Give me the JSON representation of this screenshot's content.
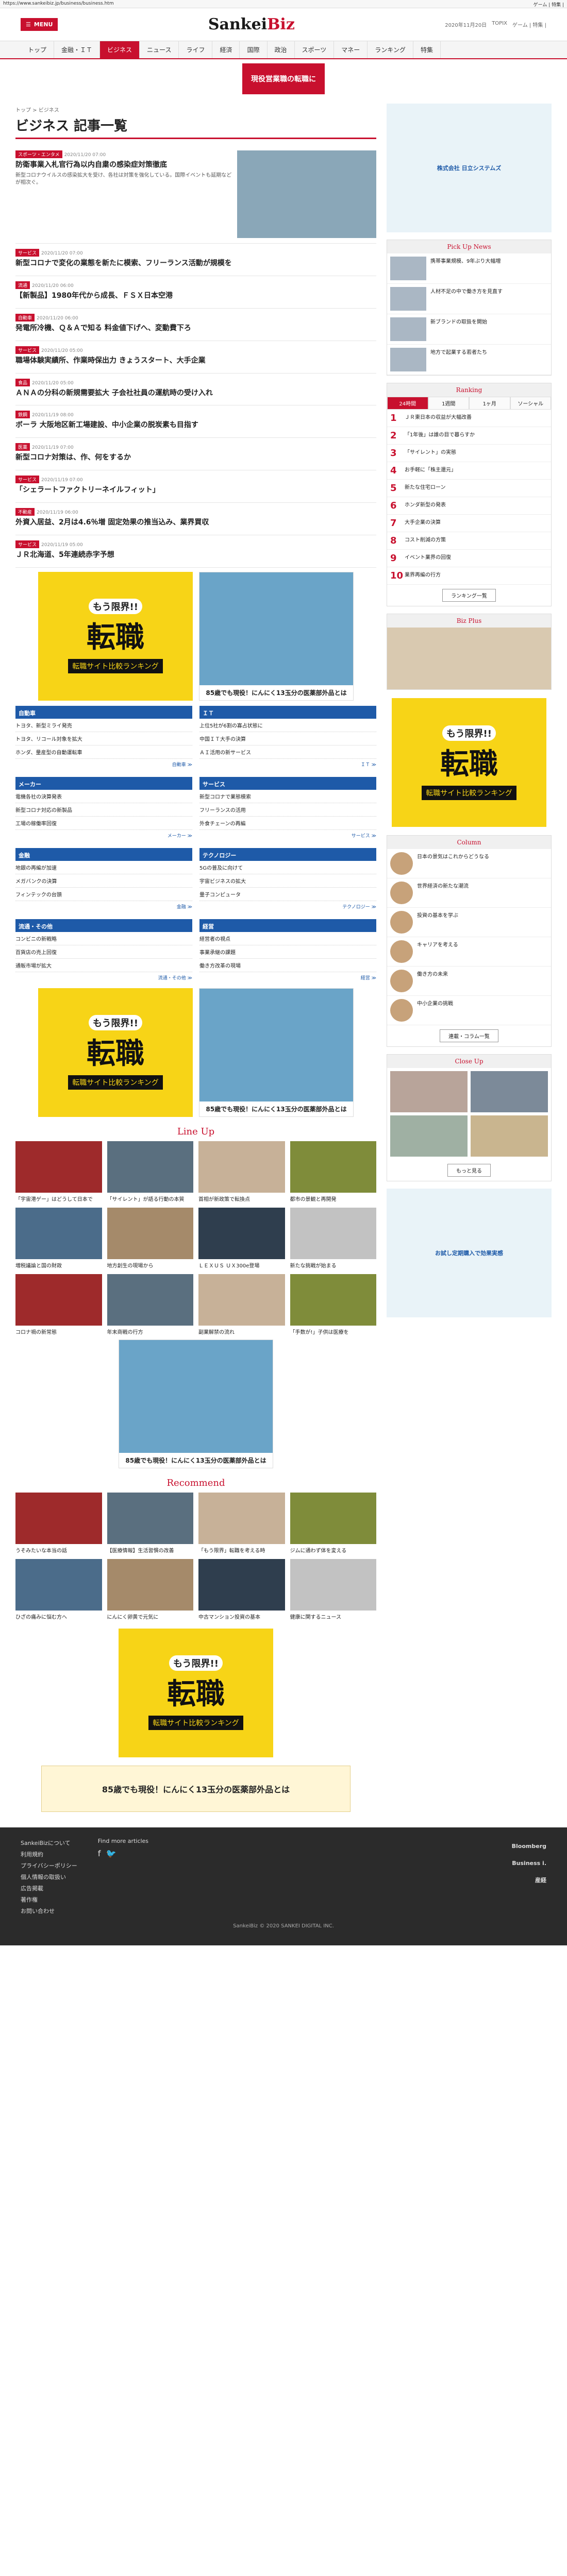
{
  "browser": {
    "url": "https://www.sankeibiz.jp/business/business.htm",
    "right": "ゲーム | 特集 |"
  },
  "header": {
    "menu": "MENU",
    "logo_a": "Sankei",
    "logo_b": "Biz",
    "date": "2020年11月20日",
    "weather": "TOPIX",
    "login": "ゲーム | 特集 |"
  },
  "nav": [
    "トップ",
    "金融・ＩＴ",
    "ビジネス",
    "ニュース",
    "ライフ",
    "経済",
    "国際",
    "政治",
    "スポーツ",
    "マネー",
    "ランキング",
    "特集"
  ],
  "top_ad": "現役営業職の転職に",
  "breadcrumb": "トップ > ビジネス",
  "page_title": "ビジネス 記事一覧",
  "articles": [
    {
      "tag": "スポーツ・エンタメ",
      "date": "2020/11/20 07:00",
      "title": "防衛事業入札官行為以内自粛の感染症対策徹底",
      "lead": "新型コロナウイルスの感染拡大を受け、各社は対策を強化している。国際イベントも延期などが相次ぐ。",
      "big": true
    },
    {
      "tag": "サービス",
      "date": "2020/11/20 07:00",
      "title": "新型コロナで変化の業態を新たに模索、フリーランス活動が規模を",
      "lead": ""
    },
    {
      "tag": "流通",
      "date": "2020/11/20 06:00",
      "title": "【新製品】1980年代から成長、ＦＳＸ日本空港",
      "lead": ""
    },
    {
      "tag": "自動車",
      "date": "2020/11/20 06:00",
      "title": "発電所冷機、Ｑ＆Ａで知る 料金値下げへ、変動費下ろ",
      "lead": ""
    },
    {
      "tag": "サービス",
      "date": "2020/11/20 05:00",
      "title": "職場体験実績所、作業時保出力 きょうスタート、大手企業",
      "lead": ""
    },
    {
      "tag": "食品",
      "date": "2020/11/20 05:00",
      "title": "ＡＮＡの分科の新規需要拡大 子会社社員の運航時の受け入れ",
      "lead": ""
    },
    {
      "tag": "鉄鋼",
      "date": "2020/11/19 08:00",
      "title": "ボーラ 大阪地区新工場建設、中小企業の脱炭素も目指す",
      "lead": ""
    },
    {
      "tag": "医薬",
      "date": "2020/11/19 07:00",
      "title": "新型コロナ対策は、作、何をするか",
      "lead": ""
    },
    {
      "tag": "サービス",
      "date": "2020/11/19 07:00",
      "title": "「シェラートファクトリーネイルフィット」",
      "lead": ""
    },
    {
      "tag": "不動産",
      "date": "2020/11/19 06:00",
      "title": "外資入居益、2月は4.6％増 固定効果の推当込み、業界買収",
      "lead": ""
    },
    {
      "tag": "サービス",
      "date": "2020/11/19 05:00",
      "title": "ＪＲ北海道、5年連続赤字予想",
      "lead": ""
    }
  ],
  "ads": {
    "moh": "もう限界!!",
    "kanji": "転職",
    "rank": "転職サイト比較ランキング",
    "pill": "85歳でも現役！にんにく13玉分の医薬部外品とは"
  },
  "categories": [
    {
      "name": "自動車",
      "items": [
        "トヨタ、新型ミライ発売",
        "トヨタ、リコール対象を拡大",
        "ホンダ、量産型の自動運転車"
      ],
      "more": "自動車 ≫"
    },
    {
      "name": "ＩＴ",
      "items": [
        "上位5社が6割の寡占状態に",
        "中国ＩＴ大手の決算",
        "ＡＩ活用の新サービス"
      ],
      "more": "ＩＴ ≫"
    },
    {
      "name": "メーカー",
      "items": [
        "電機各社の決算発表",
        "新型コロナ対応の新製品",
        "工場の稼働率回復"
      ],
      "more": "メーカー ≫"
    },
    {
      "name": "サービス",
      "items": [
        "新型コロナで業態模索",
        "フリーランスの活用",
        "外食チェーンの再編"
      ],
      "more": "サービス ≫"
    },
    {
      "name": "金融",
      "items": [
        "地銀の再編が加速",
        "メガバンクの決算",
        "フィンテックの台頭"
      ],
      "more": "金融 ≫"
    },
    {
      "name": "テクノロジー",
      "items": [
        "5Gの普及に向けて",
        "宇宙ビジネスの拡大",
        "量子コンピュータ"
      ],
      "more": "テクノロジー ≫"
    },
    {
      "name": "流通・その他",
      "items": [
        "コンビニの新戦略",
        "百貨店の売上回復",
        "通販市場が拡大"
      ],
      "more": "流通・その他 ≫"
    },
    {
      "name": "経営",
      "items": [
        "経営者の視点",
        "事業承継の課題",
        "働き方改革の現場"
      ],
      "more": "経営 ≫"
    }
  ],
  "section_lineup": "Line Up",
  "lineup": [
    "「宇宙港ゲー」はどうして日本で",
    "「サイレント」が語る行動の本質",
    "首相が新政策で転換点",
    "都市の景観と再開発",
    "増税議論と国の財政",
    "地方創生の現場から",
    "ＬＥＸＵＳ ＵＸ300e登場",
    "新たな挑戦が始まる",
    "コロナ禍の新常態",
    "年末商戦の行方",
    "副業解禁の流れ",
    "「手数が!」子供は医療を"
  ],
  "section_recommend": "Recommend",
  "recommend": [
    "うそみたいな本当の話",
    "【医療情報】生活習慣の改善",
    "「もう限界」転職を考える時",
    "ジムに通わず体を変える",
    "ひざの痛みに悩む方へ",
    "にんにく卵黄で元気に",
    "中古マンション投資の基本",
    "健康に関するニュース"
  ],
  "side": {
    "ad_company": "株式会社 日立システムズ",
    "pick_title": "Pick Up News",
    "picks": [
      "携帯事業規模、9年ぶり大幅増",
      "人材不足の中で働き方を見直す",
      "新ブランドの取扱を開始",
      "地方で起業する若者たち"
    ],
    "rank_title": "Ranking",
    "rank_tabs": [
      "24時間",
      "1週間",
      "1ヶ月",
      "ソーシャル"
    ],
    "ranks": [
      "ＪＲ東日本の収益が大幅改善",
      "「1年後」は誰の目で暮らすか",
      "「サイレント」の実態",
      "お手軽に「株主還元」",
      "新たな住宅ローン",
      "ホンダ新型の発表",
      "大手企業の決算",
      "コスト削減の方策",
      "イベント業界の回復",
      "業界再編の行方"
    ],
    "rank_more": "ランキング一覧",
    "bizplus": "Biz Plus",
    "column_title": "Column",
    "columns": [
      "日本の景気はこれからどうなる",
      "世界経済の新たな潮流",
      "投資の基本を学ぶ",
      "キャリアを考える",
      "働き方の未来",
      "中小企業の挑戦"
    ],
    "column_more": "連載・コラム一覧",
    "closeup_title": "Close Up",
    "closeup_more": "もっと見る",
    "side_ad": "お試し定期購入で効果実感"
  },
  "footer": {
    "links": [
      "SankeiBizについて",
      "利用規約",
      "プライバシーポリシー",
      "個人情報の取扱い",
      "広告掲載",
      "著作権",
      "お問い合わせ"
    ],
    "social": "Find more articles",
    "logos": [
      "Bloomberg",
      "Business i.",
      "産経"
    ],
    "copyright": "SankeiBiz © 2020 SANKEI DIGITAL INC."
  }
}
